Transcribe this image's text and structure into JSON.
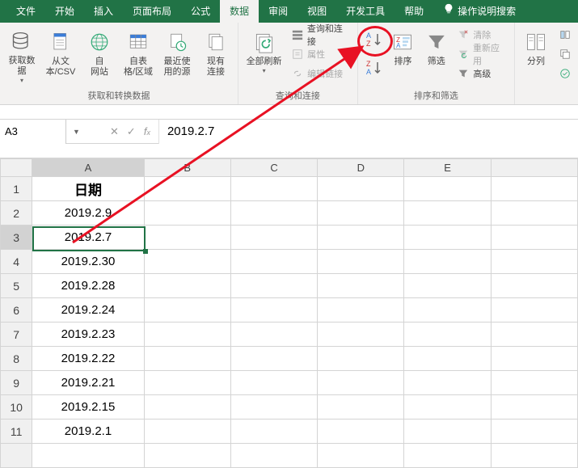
{
  "tabs": {
    "file": "文件",
    "home": "开始",
    "insert": "插入",
    "pageLayout": "页面布局",
    "formulas": "公式",
    "data": "数据",
    "review": "审阅",
    "view": "视图",
    "developer": "开发工具",
    "help": "帮助",
    "tellMe": "操作说明搜索"
  },
  "ribbon": {
    "group1_label": "获取和转换数据",
    "btn_getData": "获取数\n据",
    "btn_fromCsv": "从文\n本/CSV",
    "btn_fromWeb": "自\n网站",
    "btn_fromTable": "自表\n格/区域",
    "btn_recentSources": "最近使\n用的源",
    "btn_existingConn": "现有\n连接",
    "group2_label": "查询和连接",
    "btn_refreshAll": "全部刷新",
    "btn_queries": "查询和连接",
    "btn_properties": "属性",
    "btn_editLinks": "编辑链接",
    "group3_label": "排序和筛选",
    "btn_sortAZ": "升序",
    "btn_sortZA": "降序",
    "btn_sort": "排序",
    "btn_filter": "筛选",
    "btn_clear": "清除",
    "btn_reapply": "重新应用",
    "btn_advanced": "高级",
    "btn_textToCol": "分列"
  },
  "nameBox": "A3",
  "formulaBar": "2019.2.7",
  "columns": [
    "A",
    "B",
    "C",
    "D",
    "E"
  ],
  "selectedCell": {
    "row": 3,
    "col": "A"
  },
  "rows": [
    {
      "n": 1,
      "A": "日期"
    },
    {
      "n": 2,
      "A": "2019.2.9"
    },
    {
      "n": 3,
      "A": "2019.2.7"
    },
    {
      "n": 4,
      "A": "2019.2.30"
    },
    {
      "n": 5,
      "A": "2019.2.28"
    },
    {
      "n": 6,
      "A": "2019.2.24"
    },
    {
      "n": 7,
      "A": "2019.2.23"
    },
    {
      "n": 8,
      "A": "2019.2.22"
    },
    {
      "n": 9,
      "A": "2019.2.21"
    },
    {
      "n": 10,
      "A": "2019.2.15"
    },
    {
      "n": 11,
      "A": "2019.2.1"
    }
  ]
}
